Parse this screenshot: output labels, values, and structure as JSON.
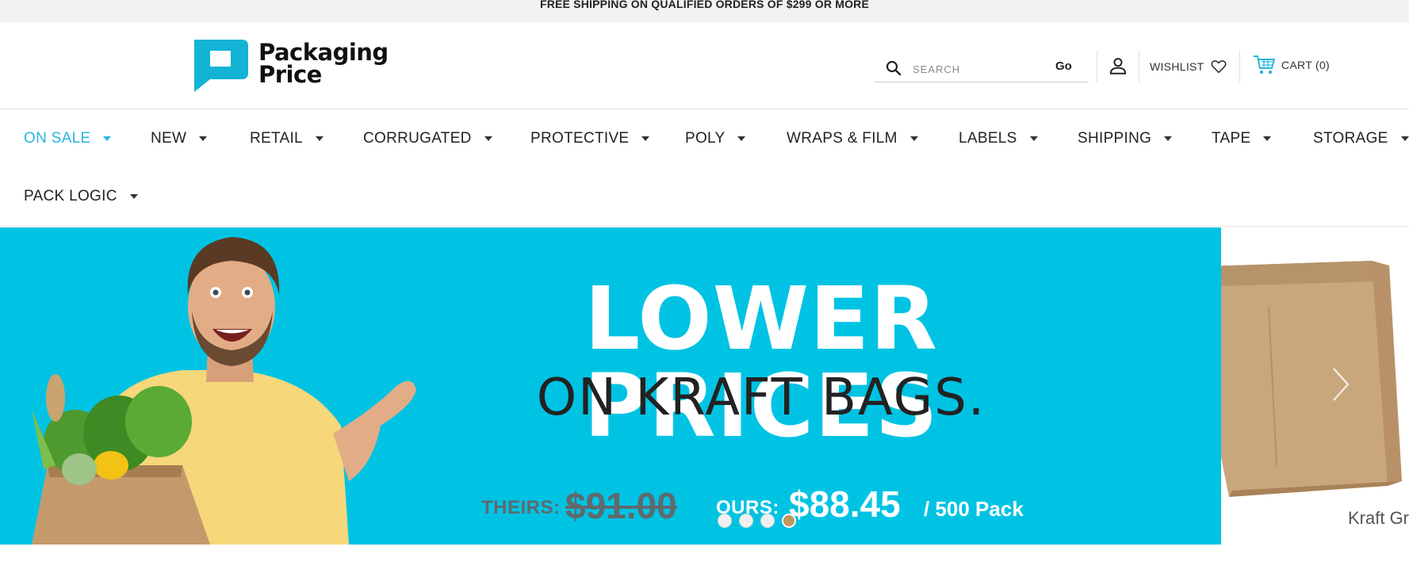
{
  "announcement": "FREE SHIPPING ON QUALIFIED ORDERS OF $299 OR MORE",
  "brand": {
    "line1": "Packaging",
    "line2": "Price",
    "color": "#13b3d6"
  },
  "search": {
    "placeholder": "SEARCH",
    "value": "",
    "go_label": "Go"
  },
  "header_links": {
    "wishlist": "WISHLIST",
    "cart": "CART (0)"
  },
  "icons": {
    "search": "search-icon",
    "account": "user-icon",
    "wishlist": "heart-icon",
    "cart": "shopping-cart-icon",
    "caret": "caret-down-icon",
    "next": "chevron-right-icon"
  },
  "nav": {
    "items": [
      {
        "label": "ON SALE",
        "active": true
      },
      {
        "label": "NEW"
      },
      {
        "label": "RETAIL"
      },
      {
        "label": "CORRUGATED"
      },
      {
        "label": "PROTECTIVE"
      },
      {
        "label": "POLY"
      },
      {
        "label": "WRAPS & FILM"
      },
      {
        "label": "LABELS"
      },
      {
        "label": "SHIPPING"
      },
      {
        "label": "TAPE"
      },
      {
        "label": "STORAGE"
      },
      {
        "label": "PACK LOGIC"
      }
    ]
  },
  "hero": {
    "title": "LOWER PRICES",
    "subtitle": "ON KRAFT BAGS.",
    "theirs_label": "THEIRS:",
    "theirs_price": "$91.00",
    "ours_label": "OURS:",
    "ours_price": "$88.45",
    "pack": "/ 500 Pack",
    "background": "#00c3e3",
    "slide_count": 4,
    "active_slide": 4
  },
  "next_slide": {
    "label": "Kraft Gr"
  },
  "colors": {
    "accent": "#2bb6dc",
    "hero_bg": "#00c3e3",
    "dot_active": "#c2955c"
  }
}
